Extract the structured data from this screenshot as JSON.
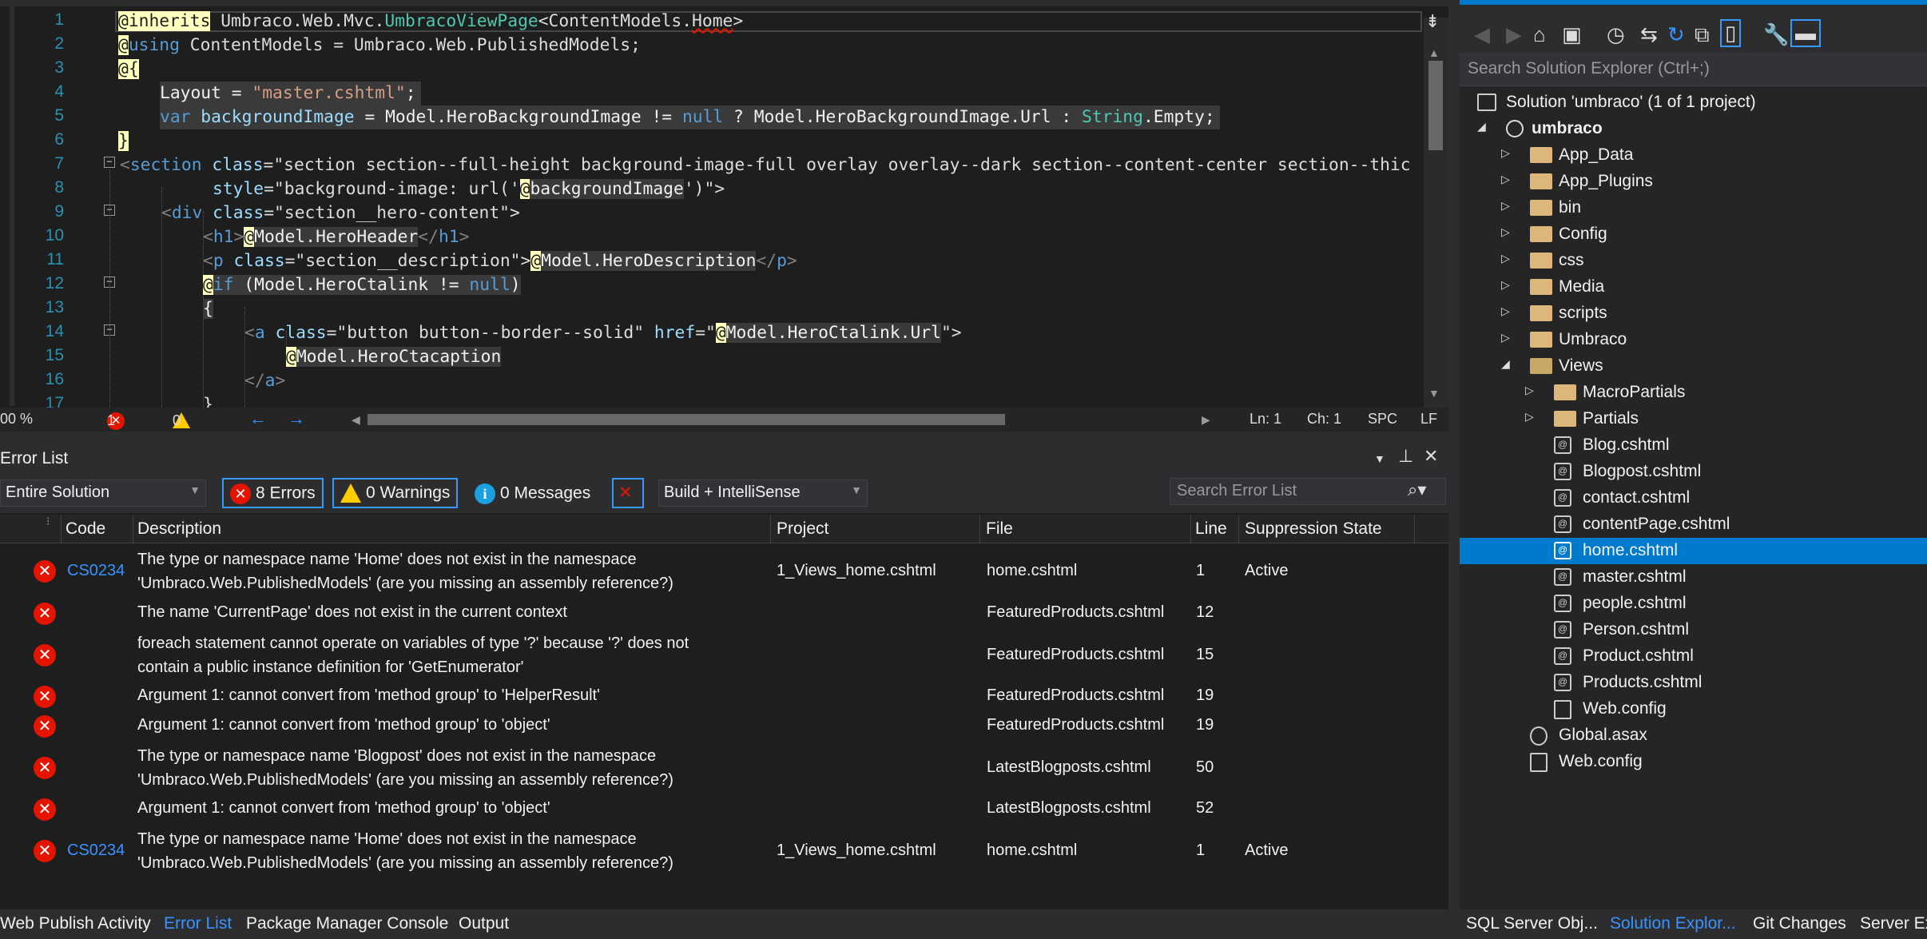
{
  "editor": {
    "tab_title": "home.cshtml",
    "line_numbers": [
      "1",
      "2",
      "3",
      "4",
      "5",
      "6",
      "7",
      "8",
      "9",
      "10",
      "11",
      "12",
      "13",
      "14",
      "15",
      "16",
      "17"
    ],
    "code": {
      "l1a": "@inherits",
      "l1b": " Umbraco.Web.Mvc.",
      "l1c": "UmbracoViewPage",
      "l1d": "<ContentModels.",
      "l1e": "Home",
      "l1f": ">",
      "l2a": "@",
      "l2b": "using",
      "l2c": " ContentModels = Umbraco.Web.PublishedModels;",
      "l3": "@{",
      "l4a": "Layout = ",
      "l4b": "\"master.cshtml\"",
      "l4c": ";",
      "l5a": "var",
      "l5b": " backgroundImage",
      "l5c": " = Model.HeroBackgroundImage != ",
      "l5d": "null",
      "l5e": " ? Model.HeroBackgroundImage.Url : ",
      "l5f": "String",
      "l5g": ".Empty;",
      "l6": "}",
      "l7a": "<",
      "l7b": "section",
      "l7c": " class",
      "l7d": "=\"section section--full-height background-image-full overlay overlay--dark section--content-center section--thic",
      "l8a": "style",
      "l8b": "=\"background-image: url('",
      "l8c": "@",
      "l8d": "backgroundImage",
      "l8e": "')\">",
      "l9a": "<",
      "l9b": "div",
      "l9c": " class",
      "l9d": "=\"section__hero-content\">",
      "l10a": "<",
      "l10b": "h1",
      "l10c": ">",
      "l10d": "@",
      "l10e": "Model.HeroHeader",
      "l10f": "</",
      "l10g": "h1",
      "l10h": ">",
      "l11a": "<",
      "l11b": "p",
      "l11c": " class",
      "l11d": "=\"section__description\">",
      "l11e": "@",
      "l11f": "Model.HeroDescription",
      "l11g": "</",
      "l11h": "p",
      "l11i": ">",
      "l12a": "@",
      "l12b": "if",
      "l12c": " (Model.HeroCtalink != ",
      "l12d": "null",
      "l12e": ")",
      "l13": "{",
      "l14a": "<",
      "l14b": "a",
      "l14c": " class",
      "l14d": "=\"button button--border--solid\"",
      "l14e": " href",
      "l14f": "=\"",
      "l14g": "@",
      "l14h": "Model.HeroCtalink.Url",
      "l14i": "\">",
      "l15a": "@",
      "l15b": "Model.HeroCtacaption",
      "l16a": "</",
      "l16b": "a",
      "l16c": ">",
      "l17": "}"
    }
  },
  "statusbar": {
    "zoom": "00 %",
    "errors": "1",
    "warnings": "0",
    "ln": "Ln: 1",
    "ch": "Ch: 1",
    "spc": "SPC",
    "lf": "LF"
  },
  "error_list": {
    "title": "Error List",
    "scope": "Entire Solution",
    "errors_btn": "8 Errors",
    "warnings_btn": "0 Warnings",
    "messages_btn": "0 Messages",
    "build_filter": "Build + IntelliSense",
    "search_placeholder": "Search Error List",
    "columns": [
      "Code",
      "Description",
      "Project",
      "File",
      "Line",
      "Suppression State"
    ],
    "rows": [
      {
        "code": "CS0234",
        "desc1": "The type or namespace name 'Home' does not exist in the namespace",
        "desc2": "'Umbraco.Web.PublishedModels' (are you missing an assembly reference?)",
        "project": "1_Views_home.cshtml",
        "file": "home.cshtml",
        "line": "1",
        "supp": "Active"
      },
      {
        "code": "",
        "desc1": "The name 'CurrentPage' does not exist in the current context",
        "desc2": "",
        "project": "",
        "file": "FeaturedProducts.cshtml",
        "line": "12",
        "supp": ""
      },
      {
        "code": "",
        "desc1": "foreach statement cannot operate on variables of type '?' because '?' does not",
        "desc2": "contain a public instance definition for 'GetEnumerator'",
        "project": "",
        "file": "FeaturedProducts.cshtml",
        "line": "15",
        "supp": ""
      },
      {
        "code": "",
        "desc1": "Argument 1: cannot convert from 'method group' to 'HelperResult'",
        "desc2": "",
        "project": "",
        "file": "FeaturedProducts.cshtml",
        "line": "19",
        "supp": ""
      },
      {
        "code": "",
        "desc1": "Argument 1: cannot convert from 'method group' to 'object'",
        "desc2": "",
        "project": "",
        "file": "FeaturedProducts.cshtml",
        "line": "19",
        "supp": ""
      },
      {
        "code": "",
        "desc1": "The type or namespace name 'Blogpost' does not exist in the namespace",
        "desc2": "'Umbraco.Web.PublishedModels' (are you missing an assembly reference?)",
        "project": "",
        "file": "LatestBlogposts.cshtml",
        "line": "50",
        "supp": ""
      },
      {
        "code": "",
        "desc1": "Argument 1: cannot convert from 'method group' to 'object'",
        "desc2": "",
        "project": "",
        "file": "LatestBlogposts.cshtml",
        "line": "52",
        "supp": ""
      },
      {
        "code": "CS0234",
        "desc1": "The type or namespace name 'Home' does not exist in the namespace",
        "desc2": "'Umbraco.Web.PublishedModels' (are you missing an assembly reference?)",
        "project": "1_Views_home.cshtml",
        "file": "home.cshtml",
        "line": "1",
        "supp": "Active"
      }
    ]
  },
  "bottom_tabs": [
    "Web Publish Activity",
    "Error List",
    "Package Manager Console",
    "Output"
  ],
  "solution_explorer": {
    "search_placeholder": "Search Solution Explorer (Ctrl+;)",
    "tree": [
      "Solution 'umbraco' (1 of 1 project)",
      "umbraco",
      "App_Data",
      "App_Plugins",
      "bin",
      "Config",
      "css",
      "Media",
      "scripts",
      "Umbraco",
      "Views",
      "MacroPartials",
      "Partials",
      "Blog.cshtml",
      "Blogpost.cshtml",
      "contact.cshtml",
      "contentPage.cshtml",
      "home.cshtml",
      "master.cshtml",
      "people.cshtml",
      "Person.cshtml",
      "Product.cshtml",
      "Products.cshtml",
      "Web.config",
      "Global.asax",
      "Web.config"
    ],
    "bottom_tabs": [
      "SQL Server Obj...",
      "Solution Explor...",
      "Git Changes",
      "Server Ex"
    ]
  },
  "colors": {
    "accent": "#007acc",
    "error": "#e51400",
    "warning": "#ffcc00",
    "link": "#3794ff"
  }
}
